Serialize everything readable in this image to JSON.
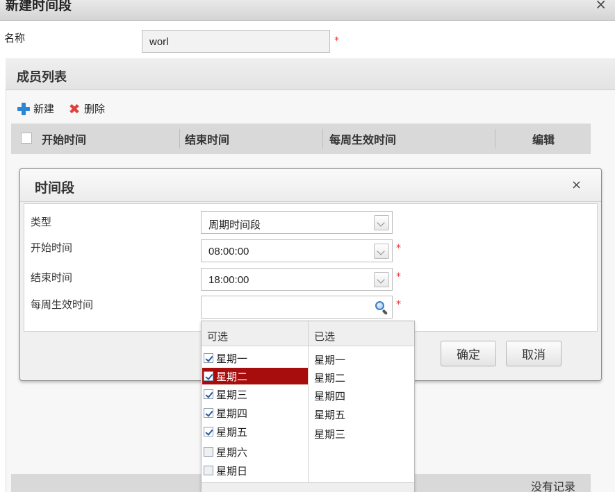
{
  "outer_dialog": {
    "title": "新建时间段",
    "close_glyph": "×",
    "name_label": "名称",
    "name_value": "worl",
    "required_mark": "*"
  },
  "members": {
    "title": "成员列表",
    "toolbar": {
      "new_label": "新建",
      "delete_label": "删除"
    },
    "columns": [
      "开始时间",
      "结束时间",
      "每周生效时间",
      "编辑"
    ],
    "empty_text": "没有记录"
  },
  "inner_dialog": {
    "title": "时间段",
    "close_glyph": "×",
    "fields": [
      {
        "label": "类型",
        "value": "周期时间段"
      },
      {
        "label": "开始时间",
        "value": "08:00:00"
      },
      {
        "label": "结束时间",
        "value": "18:00:00"
      },
      {
        "label": "每周生效时间",
        "value": ""
      }
    ],
    "ok_label": "确定",
    "cancel_label": "取消"
  },
  "weekday_picker": {
    "available_title": "可选",
    "selected_title": "已选",
    "available": [
      {
        "label": "星期一",
        "checked": true
      },
      {
        "label": "星期二",
        "checked": true
      },
      {
        "label": "星期三",
        "checked": true
      },
      {
        "label": "星期四",
        "checked": true
      },
      {
        "label": "星期五",
        "checked": true
      },
      {
        "label": "星期六",
        "checked": false
      },
      {
        "label": "星期日",
        "checked": false
      }
    ],
    "highlighted": "星期二",
    "chosen": [
      "星期一",
      "星期二",
      "星期四",
      "星期五",
      "星期三"
    ]
  },
  "colors": {
    "highlight_bg": "#a80d0d",
    "required": "#e53030",
    "plus_icon": "#2c86d1",
    "delete_icon": "#e0403a"
  },
  "icons": {
    "new": "plus-icon",
    "delete": "x-mark-icon",
    "select_arrow": "chevron-down-icon",
    "weekday_search": "magnifier-icon"
  }
}
